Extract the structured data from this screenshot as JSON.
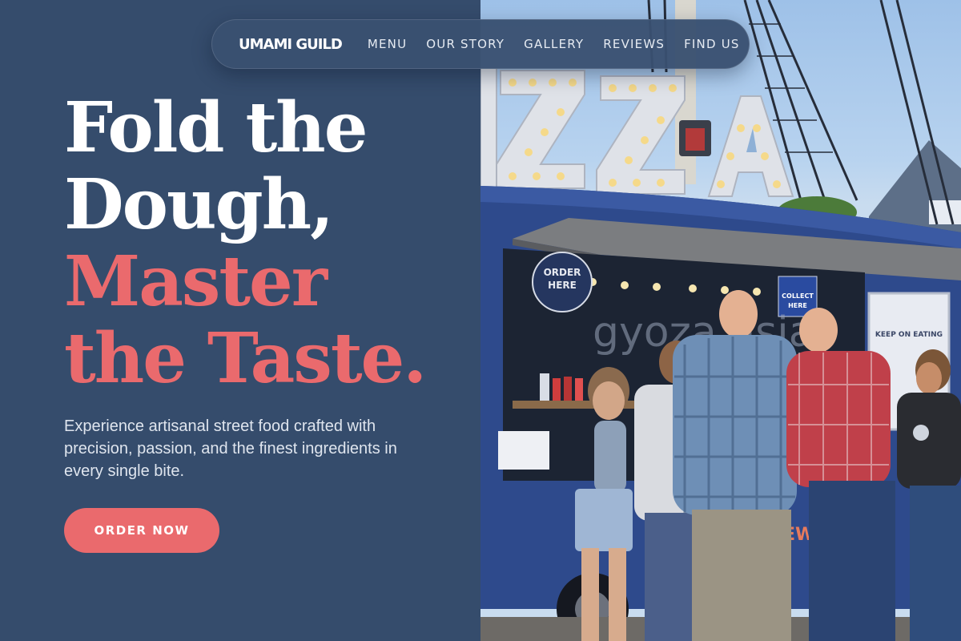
{
  "nav": {
    "brand": "UMAMI GUILD",
    "links": [
      "MENU",
      "OUR STORY",
      "GALLERY",
      "REVIEWS",
      "FIND US"
    ]
  },
  "hero": {
    "headline_lines": [
      "Fold the",
      "Dough,",
      "Master",
      "the Taste."
    ],
    "subtext": "Experience artisanal street food crafted with precision, passion, and the finest ingredients in every single bite.",
    "cta_label": "ORDER NOW"
  },
  "photo": {
    "sign_order": [
      "ORDER",
      "HERE"
    ],
    "sign_collect": [
      "COLLECT",
      "HERE"
    ],
    "truck_text": "gyoza asia",
    "poster_text": "KEEP ON EATING",
    "side_text": "EWI"
  },
  "colors": {
    "background": "#354c6c",
    "accent": "#ea6a6d",
    "text": "#ffffff",
    "truck": "#2e4a8c"
  }
}
